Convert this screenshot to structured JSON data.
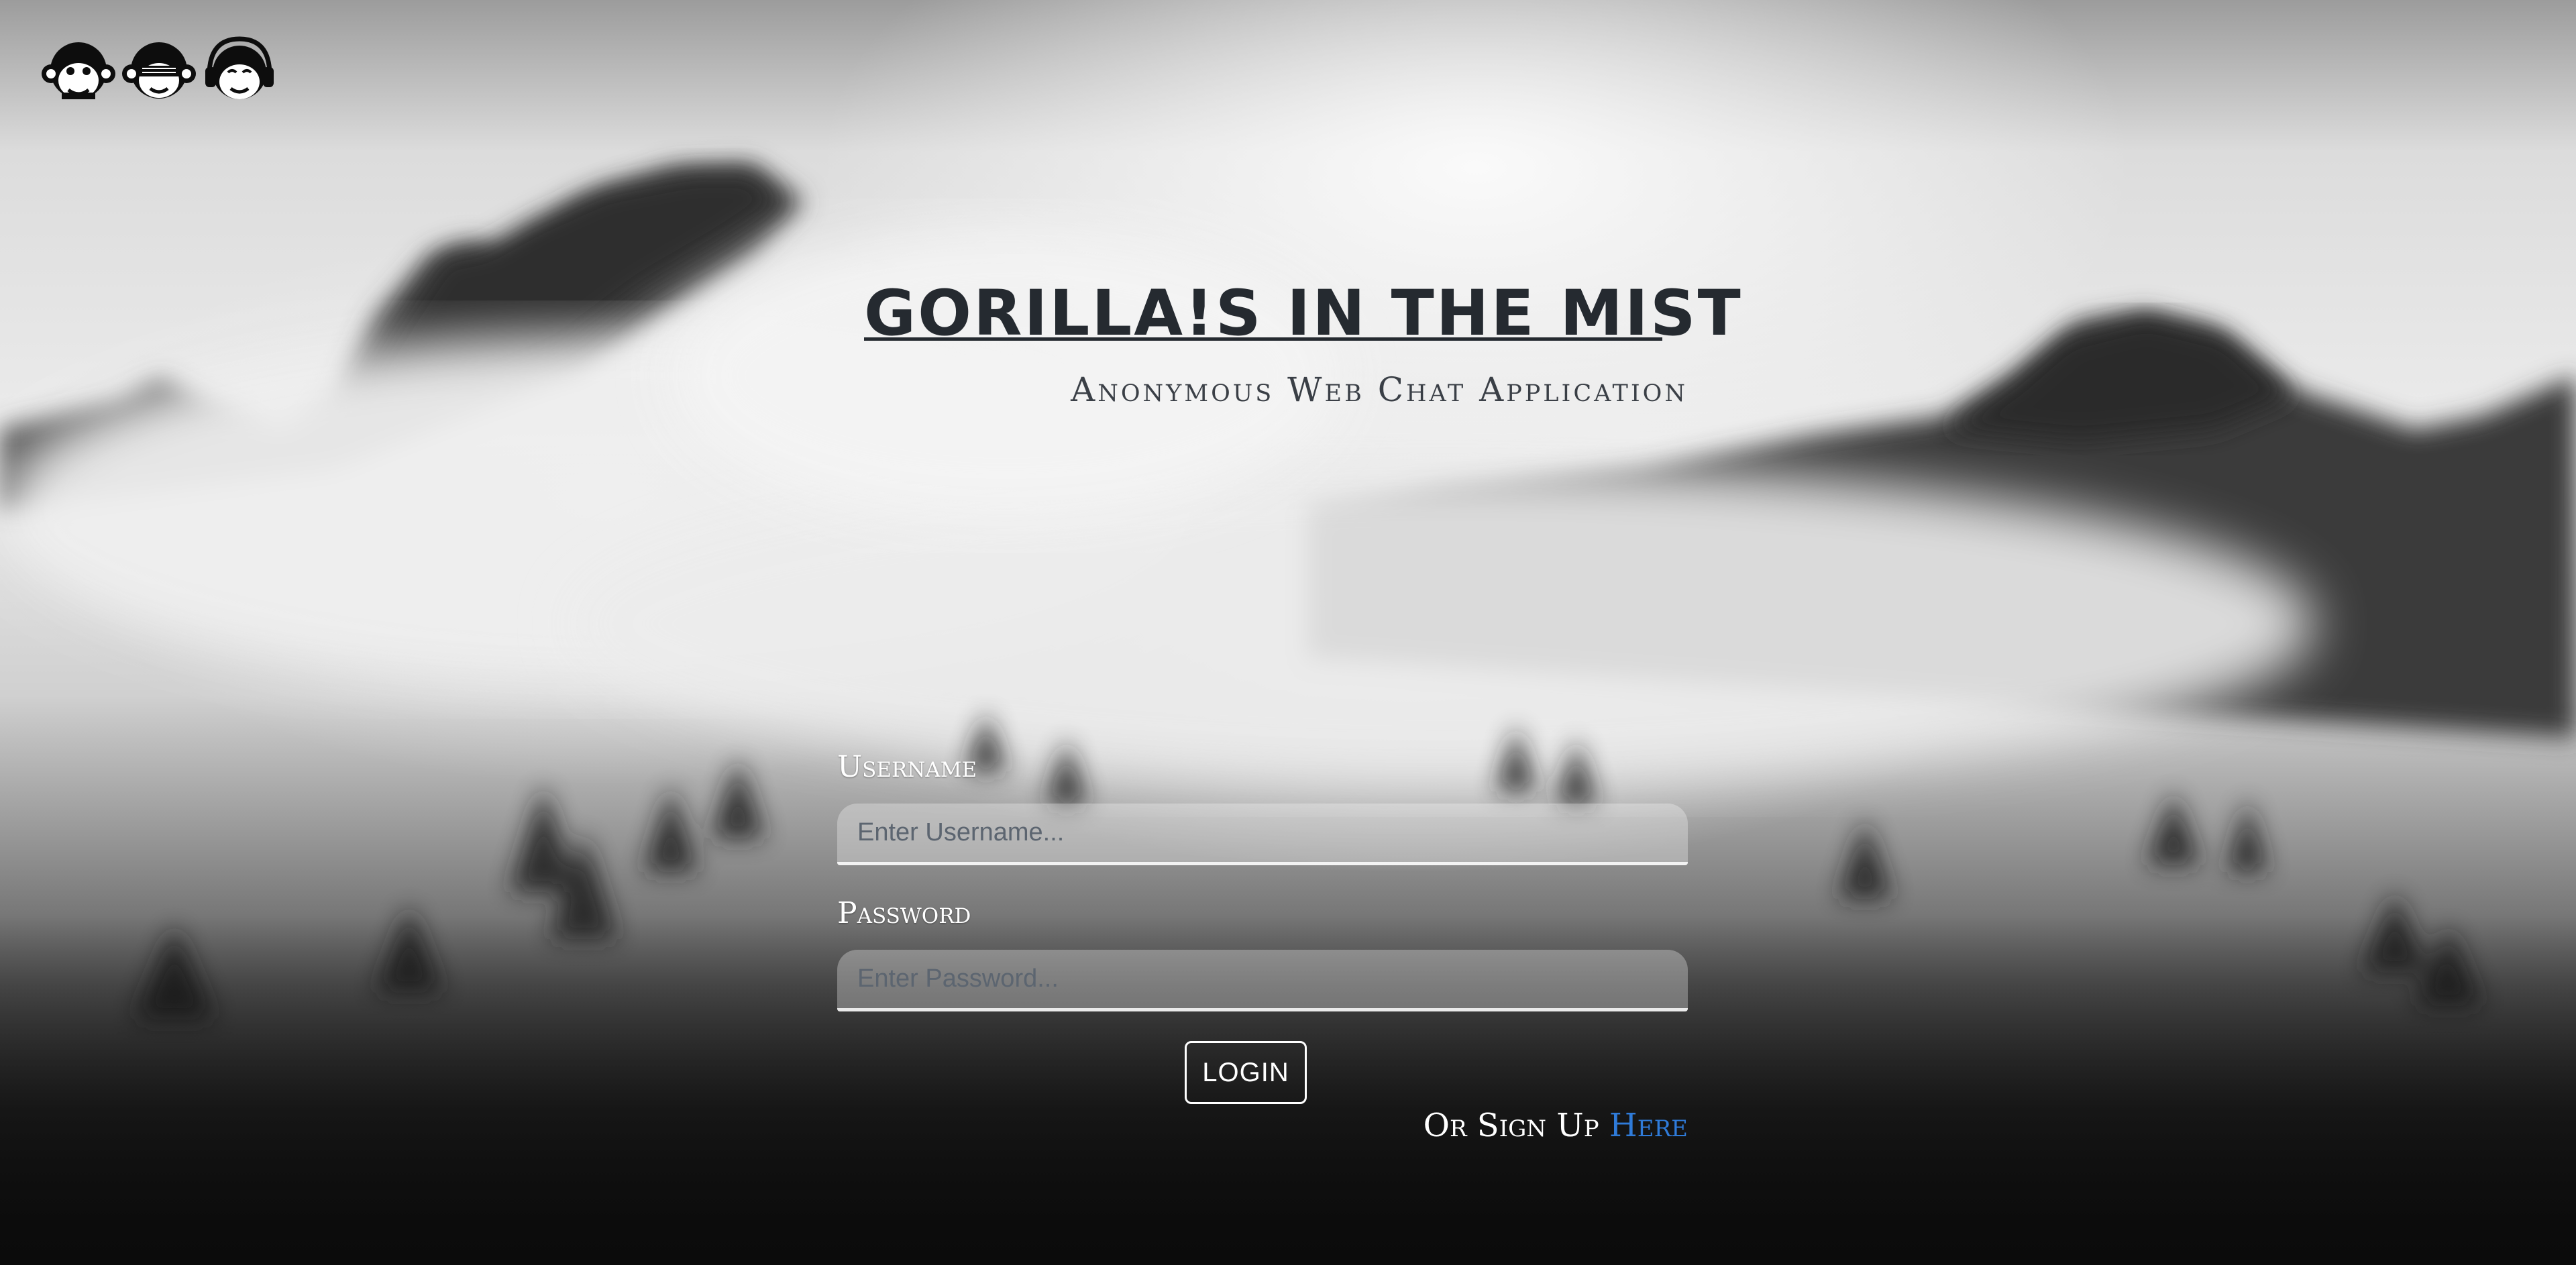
{
  "app": {
    "title": "GORILLA!S IN THE MIST",
    "subtitle": "Anonymous Web Chat Application"
  },
  "logo": {
    "icons": [
      "monkey-headphones-icon",
      "monkey-sunglasses-icon",
      "monkey-headset-icon"
    ]
  },
  "login_form": {
    "username_label": "Username",
    "username_placeholder": "Enter Username...",
    "password_label": "Password",
    "password_placeholder": "Enter Password...",
    "login_button": "LOGIN",
    "signup_prefix": "Or Sign Up",
    "signup_link": "Here"
  },
  "colors": {
    "title": "#252a30",
    "link": "#2f7bd9",
    "label": "#ffffff"
  }
}
